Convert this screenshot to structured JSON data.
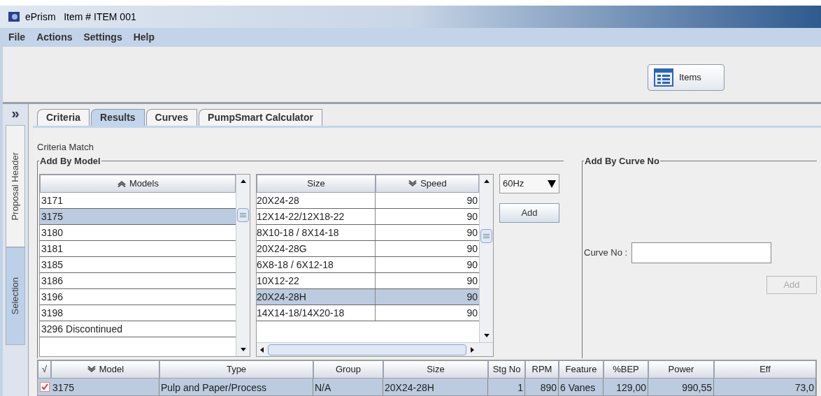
{
  "window": {
    "title": "ePrism   Item # ITEM 001"
  },
  "menu": [
    "File",
    "Actions",
    "Settings",
    "Help"
  ],
  "toolbar": {
    "items_button": "Items"
  },
  "side": {
    "expand": "»",
    "tabs": [
      {
        "label": "Proposal Header",
        "selected": false
      },
      {
        "label": "Selection",
        "selected": true
      }
    ]
  },
  "tabs": [
    {
      "label": "Criteria",
      "selected": false
    },
    {
      "label": "Results",
      "selected": true
    },
    {
      "label": "Curves",
      "selected": false
    },
    {
      "label": "PumpSmart Calculator",
      "selected": false
    }
  ],
  "criteria_match": "Criteria Match",
  "add_by_model": {
    "title": "Add By Model",
    "models_header": "Models",
    "models": [
      {
        "name": "3171",
        "selected": false
      },
      {
        "name": "3175",
        "selected": true
      },
      {
        "name": "3180",
        "selected": false
      },
      {
        "name": "3181",
        "selected": false
      },
      {
        "name": "3185",
        "selected": false
      },
      {
        "name": "3186",
        "selected": false
      },
      {
        "name": "3196",
        "selected": false
      },
      {
        "name": "3198",
        "selected": false
      },
      {
        "name": "3296 Discontinued",
        "selected": false
      }
    ],
    "size_header": "Size",
    "speed_header": "Speed",
    "sizes": [
      {
        "size": "20X24-28",
        "speed": "90",
        "selected": false
      },
      {
        "size": "12X14-22/12X18-22",
        "speed": "90",
        "selected": false
      },
      {
        "size": "8X10-18 / 8X14-18",
        "speed": "90",
        "selected": false
      },
      {
        "size": "20X24-28G",
        "speed": "90",
        "selected": false
      },
      {
        "size": "6X8-18 / 6X12-18",
        "speed": "90",
        "selected": false
      },
      {
        "size": "10X12-22",
        "speed": "90",
        "selected": false
      },
      {
        "size": "20X24-28H",
        "speed": "90",
        "selected": true
      },
      {
        "size": "14X14-18/14X20-18",
        "speed": "90",
        "selected": false
      }
    ],
    "frequency": "60Hz",
    "add_button": "Add"
  },
  "add_by_curve": {
    "title": "Add By Curve No",
    "label": "Curve No :",
    "add_button": "Add",
    "add_disabled": true
  },
  "results": {
    "check_header": "√",
    "columns": [
      "Model",
      "Type",
      "Group",
      "Size",
      "Stg No",
      "RPM",
      "Feature",
      "%BEP",
      "Power",
      "Eff"
    ],
    "rows": [
      {
        "checked": true,
        "selected": true,
        "cells": [
          "3175",
          "Pulp and Paper/Process",
          "N/A",
          "20X24-28H",
          "1",
          "890",
          "6 Vanes",
          "129,00",
          "990,55",
          "73,0"
        ]
      }
    ]
  }
}
